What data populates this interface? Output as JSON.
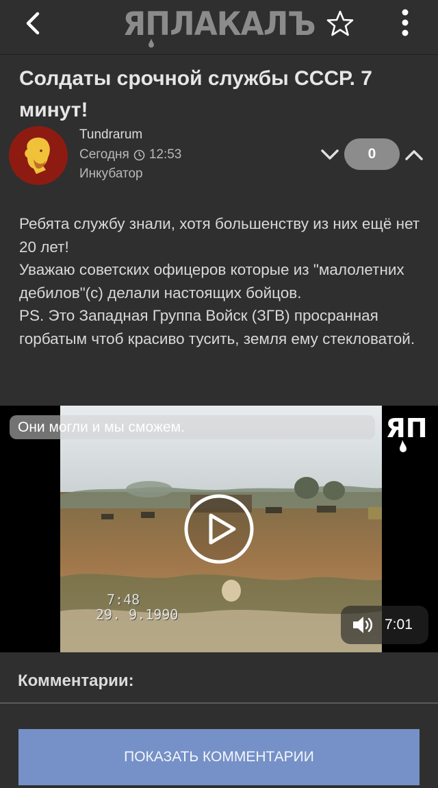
{
  "header": {
    "logo_text": "ЯПЛАКАЛЪ",
    "back_icon": "chevron-left-icon",
    "favorite_icon": "star-outline-icon",
    "menu_icon": "more-vertical-icon"
  },
  "post": {
    "title": "Солдаты срочной службы СССР. 7 минут!",
    "author": "Tundrarum",
    "date": "Сегодня",
    "time": "12:53",
    "category": "Инкубатор",
    "score": "0",
    "body": [
      "Ребята службу знали, хотя большенству из них ещё нет 20 лет!",
      "Уважаю советских офицеров которые из \"малолетних дебилов\"(с) делали настоящих бойцов.",
      "PS. Это Западная Группа Войск (ЗГВ) просранная горбатым чтоб красиво тусить, земля ему стекловатой."
    ]
  },
  "video": {
    "caption": "Они могли и мы сможем.",
    "stamp_time": "7:48",
    "stamp_date": "29. 9.1990",
    "duration": "7:01"
  },
  "comments": {
    "heading": "Комментарии:",
    "show_button": "ПОКАЗАТЬ КОММЕНТАРИИ"
  },
  "colors": {
    "background": "#2f2f2f",
    "score_pill": "#8c8c8c",
    "button": "#7691c7",
    "avatar_bg": "#8d1b12"
  }
}
